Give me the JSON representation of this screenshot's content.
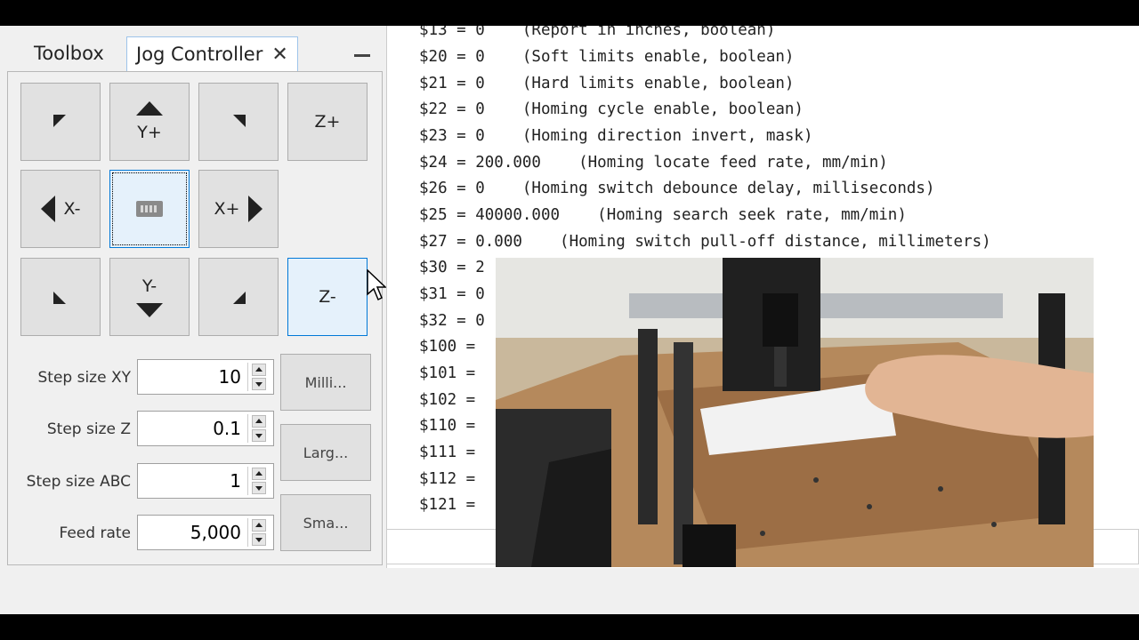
{
  "tabs": {
    "toolbox": "Toolbox",
    "jog": "Jog Controller",
    "close_glyph": "✕"
  },
  "jog_buttons": {
    "y_plus": "Y+",
    "z_plus": "Z+",
    "x_minus": "X-",
    "x_plus": "X+",
    "y_minus": "Y-",
    "z_minus": "Z-"
  },
  "settings": [
    {
      "label": "Step size XY",
      "value": "10"
    },
    {
      "label": "Step size Z",
      "value": "0.1"
    },
    {
      "label": "Step size ABC",
      "value": "1"
    },
    {
      "label": "Feed rate",
      "value": "5,000"
    }
  ],
  "unit_buttons": [
    "Milli...",
    "Larg...",
    "Sma..."
  ],
  "console_lines": [
    "$13 = 0    (Report in inches, boolean)",
    "$20 = 0    (Soft limits enable, boolean)",
    "$21 = 0    (Hard limits enable, boolean)",
    "$22 = 0    (Homing cycle enable, boolean)",
    "$23 = 0    (Homing direction invert, mask)",
    "$24 = 200.000    (Homing locate feed rate, mm/min)",
    "$26 = 0    (Homing switch debounce delay, milliseconds)",
    "$25 = 40000.000    (Homing search seek rate, mm/min)",
    "$27 = 0.000    (Homing switch pull-off distance, millimeters)",
    "$30 = 2",
    "$31 = 0",
    "$32 = 0",
    "$100 =",
    "$101 =",
    "$102 =",
    "$110 =",
    "$111 =",
    "$112 =",
    "$121 ="
  ],
  "colors": {
    "accent": "#0078d7",
    "button_face": "#e1e1e1",
    "highlight": "#e5f1fb"
  },
  "icons": [
    "keyboard-icon",
    "arrow-up-icon",
    "arrow-down-icon",
    "arrow-left-icon",
    "arrow-right-icon",
    "diagonal-arrow-icon",
    "close-icon",
    "minimize-icon",
    "mouse-cursor-icon"
  ]
}
